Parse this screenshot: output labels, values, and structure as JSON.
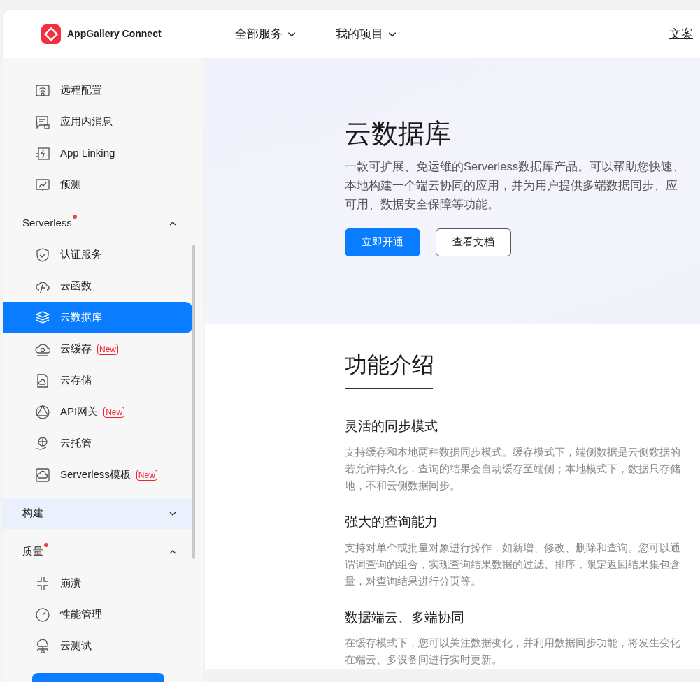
{
  "header": {
    "brand": "AppGallery Connect",
    "menus": [
      {
        "label": "全部服务"
      },
      {
        "label": "我的项目"
      }
    ],
    "right_link": "文案"
  },
  "sidebar": {
    "groups": [
      {
        "items": [
          {
            "label": "远程配置",
            "selected": false
          },
          {
            "label": "应用内消息",
            "selected": false
          },
          {
            "label": "App Linking",
            "selected": false
          },
          {
            "label": "预测",
            "selected": false
          }
        ]
      },
      {
        "title": "Serverless",
        "dot": true,
        "expanded": true,
        "hovered": false,
        "items": [
          {
            "label": "认证服务",
            "selected": false
          },
          {
            "label": "云函数",
            "selected": false
          },
          {
            "label": "云数据库",
            "selected": true
          },
          {
            "label": "云缓存",
            "badge": "New",
            "selected": false
          },
          {
            "label": "云存储",
            "selected": false
          },
          {
            "label": "API网关",
            "badge": "New",
            "selected": false
          },
          {
            "label": "云托管",
            "selected": false
          },
          {
            "label": "Serverless模板",
            "badge": "New",
            "selected": false
          }
        ]
      },
      {
        "title": "构建",
        "dot": false,
        "expanded": false,
        "hovered": true
      },
      {
        "title": "质量",
        "dot": true,
        "expanded": true,
        "hovered": false,
        "items": [
          {
            "label": "崩溃",
            "selected": false
          },
          {
            "label": "性能管理",
            "selected": false
          },
          {
            "label": "云测试",
            "selected": false
          }
        ]
      }
    ]
  },
  "hero": {
    "title": "云数据库",
    "description": [
      "一款可扩展、免运维的Serverless数据库产品。可以帮助您快速、",
      "本地构建一个端云协同的应用，并为用户提供多端数据同步、应",
      "可用、数据安全保障等功能。"
    ],
    "buttons": [
      {
        "label": "立即开通",
        "kind": "primary"
      },
      {
        "label": "查看文档",
        "kind": "outline"
      }
    ]
  },
  "features": {
    "title": "功能介绍",
    "items": [
      {
        "title": "灵活的同步模式",
        "lines": [
          "支持缓存和本地两种数据同步模式。缓存模式下，端侧数据是云侧数据的",
          "若允许持久化，查询的结果会自动缓存至端侧；本地模式下，数据只存储",
          "地，不和云侧数据同步。"
        ]
      },
      {
        "title": "强大的查询能力",
        "lines": [
          "支持对单个或批量对象进行操作，如新增、修改、删除和查询。您可以通",
          "谓词查询的组合，实现查询结果数据的过滤、排序，限定返回结果集包含",
          "量，对查询结果进行分页等。"
        ]
      },
      {
        "title": "数据端云、多端协同",
        "lines": [
          "在缓存模式下，您可以关注数据变化，并利用数据同步功能，将发生变化",
          "在端云、多设备间进行实时更新。"
        ]
      }
    ]
  }
}
